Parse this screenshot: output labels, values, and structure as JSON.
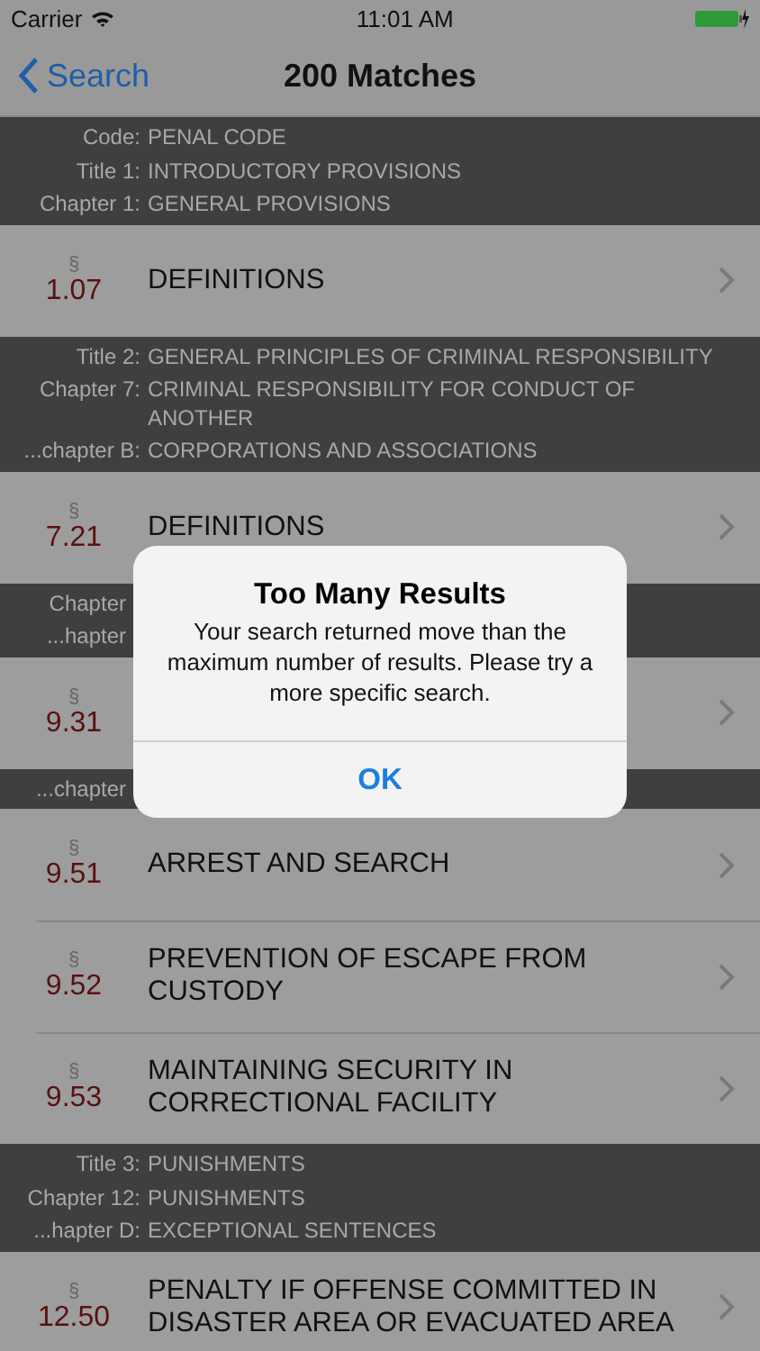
{
  "status_bar": {
    "carrier": "Carrier",
    "time": "11:01 AM"
  },
  "nav": {
    "back": "Search",
    "title": "200 Matches"
  },
  "sections": [
    {
      "header": [
        {
          "label": "Code:",
          "value": "PENAL CODE"
        },
        {
          "label": "Title 1:",
          "value": "INTRODUCTORY PROVISIONS"
        },
        {
          "label": "Chapter 1:",
          "value": "GENERAL PROVISIONS"
        }
      ],
      "rows": [
        {
          "symbol": "§",
          "number": "1.07",
          "title": "DEFINITIONS"
        }
      ]
    },
    {
      "header": [
        {
          "label": "Title 2:",
          "value": "GENERAL PRINCIPLES OF CRIMINAL RESPONSIBILITY"
        },
        {
          "label": "Chapter 7:",
          "value": "CRIMINAL RESPONSIBILITY FOR CONDUCT OF ANOTHER"
        },
        {
          "label": "...chapter B:",
          "value": "CORPORATIONS AND ASSOCIATIONS"
        }
      ],
      "rows": [
        {
          "symbol": "§",
          "number": "7.21",
          "title": "DEFINITIONS"
        }
      ]
    },
    {
      "header": [
        {
          "label": "Chapter"
        },
        {
          "label": "...hapter"
        }
      ],
      "rows": [
        {
          "symbol": "§",
          "number": "9.31"
        }
      ]
    },
    {
      "header": [
        {
          "label": "...chapter"
        }
      ],
      "rows": [
        {
          "symbol": "§",
          "number": "9.51",
          "title": "ARREST AND SEARCH"
        },
        {
          "symbol": "§",
          "number": "9.52",
          "title": "PREVENTION OF ESCAPE FROM CUSTODY"
        },
        {
          "symbol": "§",
          "number": "9.53",
          "title": "MAINTAINING SECURITY IN CORRECTIONAL FACILITY"
        }
      ]
    },
    {
      "header": [
        {
          "label": "Title 3:",
          "value": "PUNISHMENTS"
        },
        {
          "label": "Chapter 12:",
          "value": "PUNISHMENTS"
        },
        {
          "label": "...hapter D:",
          "value": "EXCEPTIONAL SENTENCES"
        }
      ],
      "rows": [
        {
          "symbol": "§",
          "number": "12.50",
          "title": "PENALTY IF OFFENSE COMMITTED IN DISASTER AREA OR EVACUATED AREA"
        }
      ]
    }
  ],
  "alert": {
    "title": "Too Many Results",
    "message": "Your search returned move than the maximum number of results. Please try a more specific search.",
    "button": "OK"
  }
}
